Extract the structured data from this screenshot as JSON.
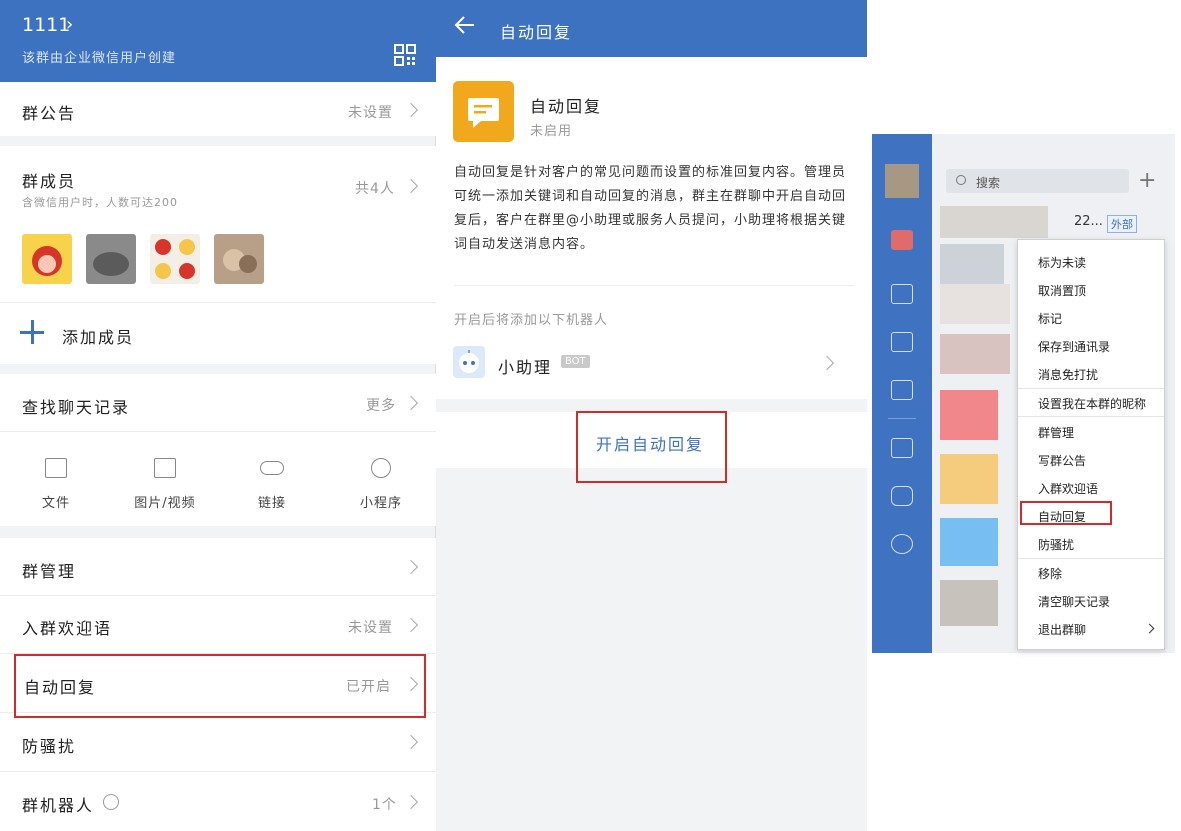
{
  "left": {
    "group_name": "1111",
    "group_sub": "该群由企业微信用户创建",
    "announcement": {
      "label": "群公告",
      "value": "未设置"
    },
    "members": {
      "label": "群成员",
      "hint": "含微信用户时，人数可达200",
      "count": "共4人"
    },
    "add_member": "添加成员",
    "search_history": {
      "label": "查找聊天记录",
      "value": "更多"
    },
    "tools": [
      {
        "label": "文件",
        "icon": "folder-icon"
      },
      {
        "label": "图片/视频",
        "icon": "image-icon"
      },
      {
        "label": "链接",
        "icon": "link-icon"
      },
      {
        "label": "小程序",
        "icon": "mini-program-icon"
      }
    ],
    "group_manage": "群管理",
    "welcome": {
      "label": "入群欢迎语",
      "value": "未设置"
    },
    "auto_reply": {
      "label": "自动回复",
      "value": "已开启"
    },
    "anti_spam": "防骚扰",
    "robot": {
      "label": "群机器人",
      "value": "1个"
    }
  },
  "middle": {
    "title": "自动回复",
    "card_title": "自动回复",
    "card_status": "未启用",
    "description": "自动回复是针对客户的常见问题而设置的标准回复内容。管理员可统一添加关键词和自动回复的消息，群主在群聊中开启自动回复后，客户在群里@小助理或服务人员提问，小助理将根据关键词自动发送消息内容。",
    "robot_hint": "开启后将添加以下机器人",
    "bot_name": "小助理",
    "bot_tag": "BOT",
    "enable_button": "开启自动回复"
  },
  "right": {
    "search_placeholder": "搜索",
    "chat_num": "22...",
    "ext_tag": "外部",
    "menu": [
      "标为未读",
      "取消置顶",
      "标记",
      "保存到通讯录",
      "消息免打扰",
      "设置我在本群的昵称",
      "群管理",
      "写群公告",
      "入群欢迎语",
      "自动回复",
      "防骚扰",
      "移除",
      "清空聊天记录",
      "退出群聊"
    ]
  },
  "colors": {
    "brand_blue": "#3c72c0",
    "highlight_red": "#d42a2a",
    "auto_reply_orange": "#f2a81d"
  }
}
